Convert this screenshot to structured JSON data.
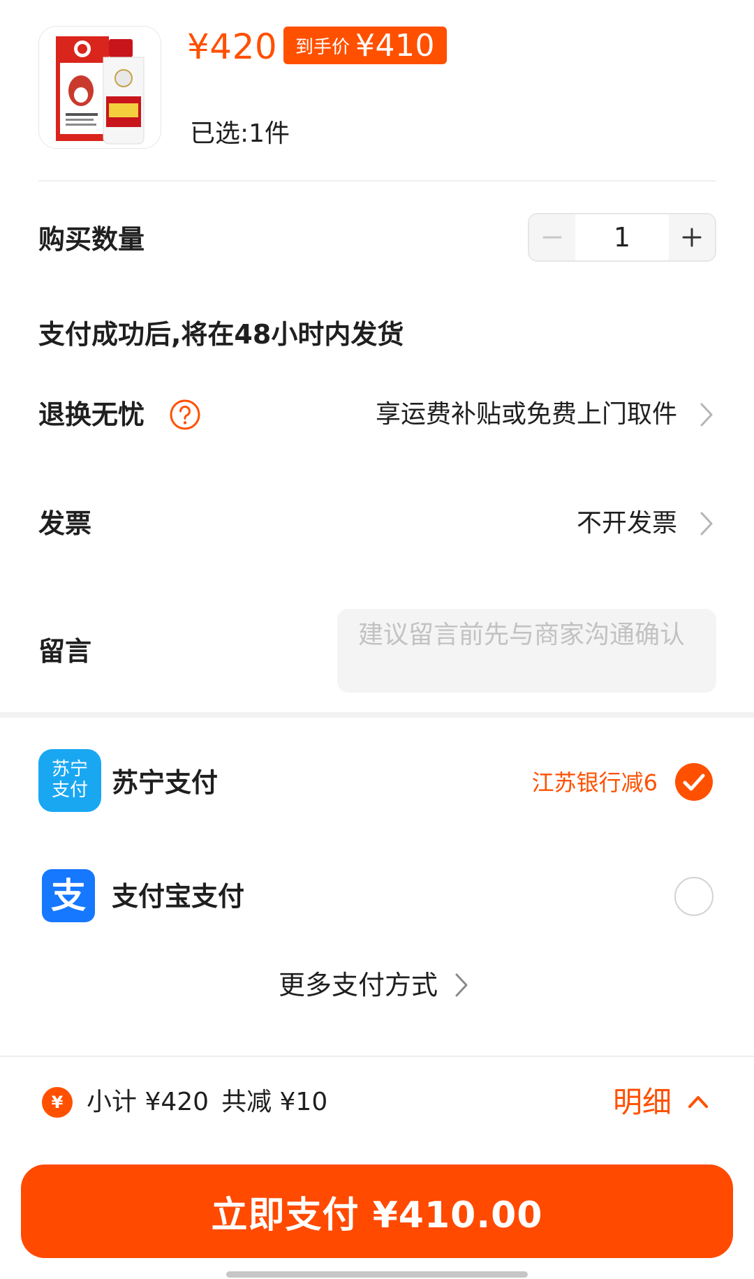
{
  "product": {
    "price": "¥420",
    "final_price_label": "到手价",
    "final_price": "¥410",
    "selected_count": "已选:1件"
  },
  "quantity": {
    "label": "购买数量",
    "value": "1",
    "minus_icon": "minus-icon",
    "plus_icon": "plus-icon"
  },
  "shipping_notice": "支付成功后,将在48小时内发货",
  "returns": {
    "label": "退换无忧",
    "value": "享运费补贴或免费上门取件"
  },
  "invoice": {
    "label": "发票",
    "value": "不开发票"
  },
  "note": {
    "label": "留言",
    "placeholder": "建议留言前先与商家沟通确认"
  },
  "payments": {
    "options": [
      {
        "icon_text": [
          "苏宁",
          "支付"
        ],
        "label": "苏宁支付",
        "promo": "江苏银行减6",
        "selected": true
      },
      {
        "icon_text": "支",
        "label": "支付宝支付",
        "selected": false
      }
    ],
    "more_label": "更多支付方式"
  },
  "summary": {
    "subtotal": "小计 ¥420",
    "discount": "共减 ¥10",
    "details_label": "明细"
  },
  "pay_button": {
    "label": "立即支付 ¥410.00"
  },
  "colors": {
    "accent": "#ff5000",
    "pay_button": "#ff4a00",
    "suning_blue": "#1aa7f2",
    "alipay_blue": "#1677ff"
  }
}
